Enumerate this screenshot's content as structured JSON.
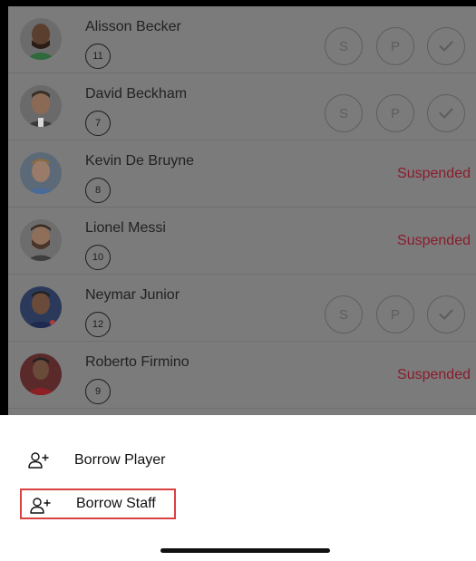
{
  "players": [
    {
      "name": "Alisson Becker",
      "number": "11",
      "state": "actions"
    },
    {
      "name": "David Beckham",
      "number": "7",
      "state": "actions"
    },
    {
      "name": "Kevin De Bruyne",
      "number": "8",
      "state": "suspended"
    },
    {
      "name": "Lionel Messi",
      "number": "10",
      "state": "suspended"
    },
    {
      "name": "Neymar Junior",
      "number": "12",
      "state": "actions"
    },
    {
      "name": "Roberto Firmino",
      "number": "9",
      "state": "suspended"
    }
  ],
  "labels": {
    "suspended": "Suspended",
    "btn_s": "S",
    "btn_p": "P"
  },
  "menu": {
    "borrow_player": "Borrow Player",
    "borrow_staff": "Borrow Staff"
  },
  "icons": {
    "player_avatar": "person-photo",
    "add_person": "add-person-icon",
    "check": "checkmark-icon"
  },
  "colors": {
    "overlay": "#7b7b7b",
    "suspended": "#8a1c2d",
    "highlight_border": "#d94141",
    "sheet": "#ffffff"
  }
}
